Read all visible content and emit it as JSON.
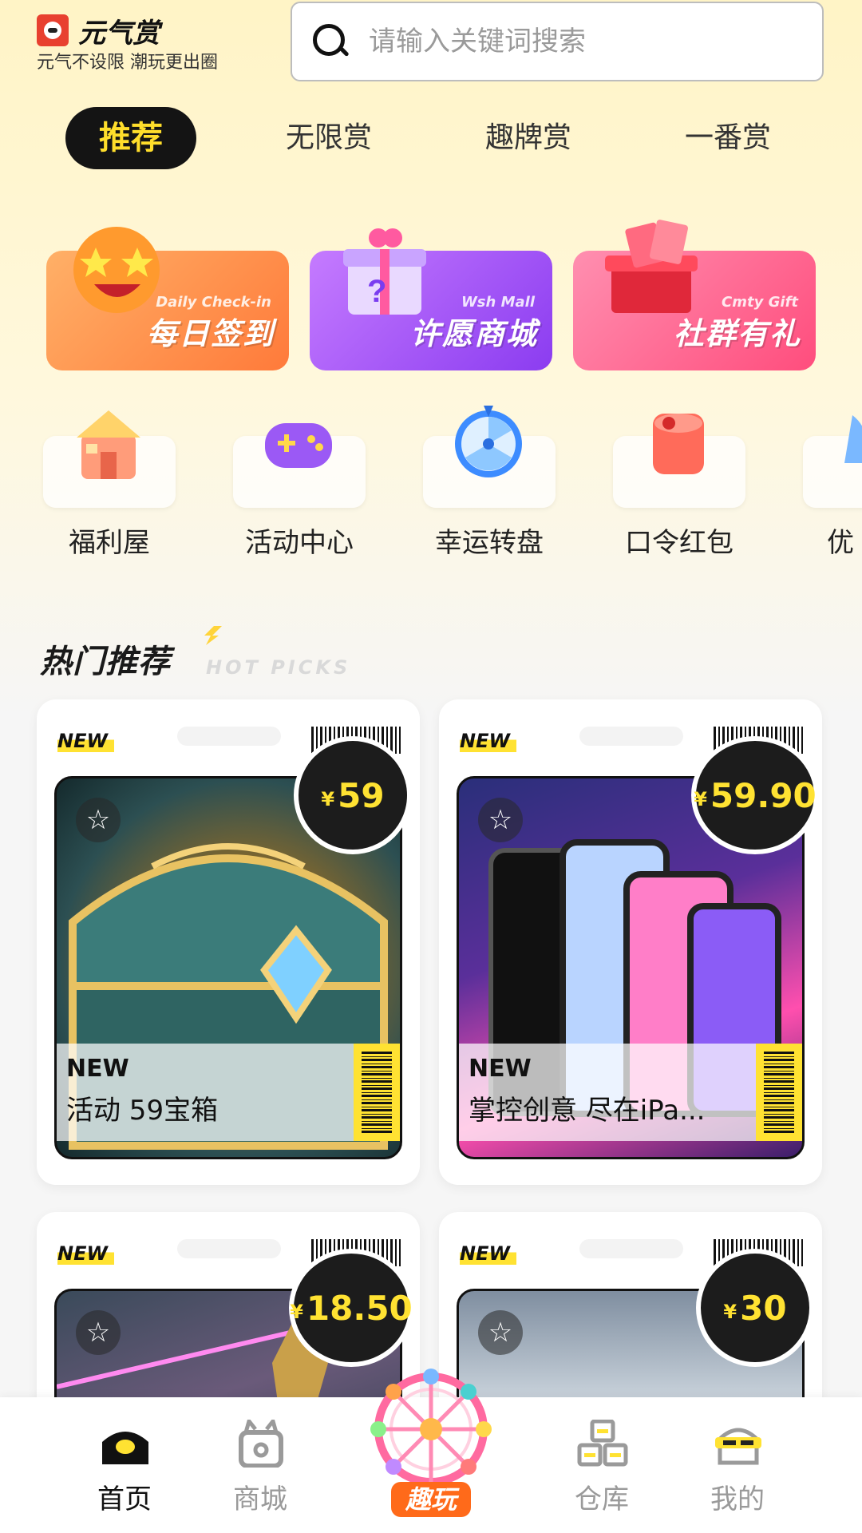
{
  "header": {
    "app_name": "元气赏",
    "slogan": "元气不设限 潮玩更出圈",
    "search_placeholder": "请输入关键词搜索",
    "search_icon": "search-icon"
  },
  "tabs": [
    {
      "label": "推荐",
      "active": true
    },
    {
      "label": "无限赏",
      "active": false
    },
    {
      "label": "趣牌赏",
      "active": false
    },
    {
      "label": "一番赏",
      "active": false
    }
  ],
  "banners": [
    {
      "title": "每日签到",
      "subtitle": "Daily Check-in",
      "color": "#ff8a4a"
    },
    {
      "title": "许愿商城",
      "subtitle": "Wsh Mall",
      "color": "#a855f7"
    },
    {
      "title": "社群有礼",
      "subtitle": "Cmty Gift",
      "color": "#ff5a8a"
    }
  ],
  "quick_entries": [
    {
      "label": "福利屋",
      "icon": "gift-house-icon"
    },
    {
      "label": "活动中心",
      "icon": "gamepad-icon"
    },
    {
      "label": "幸运转盘",
      "icon": "wheel-icon"
    },
    {
      "label": "口令红包",
      "icon": "red-packet-icon"
    },
    {
      "label": "优",
      "icon": "coupon-icon"
    }
  ],
  "section": {
    "title": "热门推荐",
    "subtitle": "HOT PICKS"
  },
  "products": [
    {
      "tag": "NEW",
      "price_currency": "¥",
      "price": "59",
      "ov_tag": "NEW",
      "name": "活动 59宝箱"
    },
    {
      "tag": "NEW",
      "price_currency": "¥",
      "price": "59.90",
      "ov_tag": "NEW",
      "name": "掌控创意 尽在iPa..."
    },
    {
      "tag": "NEW",
      "price_currency": "¥",
      "price": "18.50",
      "ov_tag": "",
      "name": ""
    },
    {
      "tag": "NEW",
      "price_currency": "¥",
      "price": "30",
      "ov_tag": "",
      "name": ""
    }
  ],
  "nav": [
    {
      "label": "首页",
      "icon": "home-icon",
      "active": true
    },
    {
      "label": "商城",
      "icon": "shop-icon",
      "active": false
    },
    {
      "label": "趣玩",
      "icon": "ferris-wheel-icon",
      "active": false
    },
    {
      "label": "仓库",
      "icon": "warehouse-icon",
      "active": false
    },
    {
      "label": "我的",
      "icon": "profile-icon",
      "active": false
    }
  ]
}
